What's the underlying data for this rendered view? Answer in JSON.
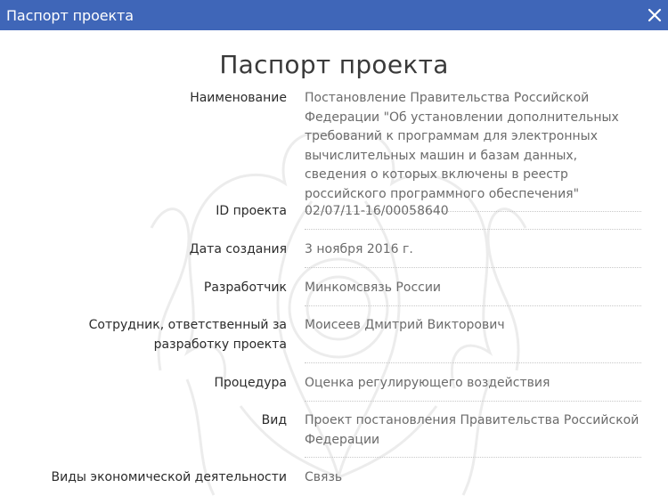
{
  "window": {
    "title": "Паспорт проекта",
    "close_icon": "close-icon"
  },
  "page": {
    "heading": "Паспорт проекта"
  },
  "fields": [
    {
      "label": "Наименование",
      "value": "Постановление Правительства Российской Федерации \"Об установлении дополнительных требований к программам для электронных вычислительных машин и базам данных, сведения о которых включены в реестр российского программного обеспечения\""
    },
    {
      "label": "ID проекта",
      "value": "02/07/11-16/00058640"
    },
    {
      "label": "Дата создания",
      "value": "3 ноября 2016 г."
    },
    {
      "label": "Разработчик",
      "value": "Минкомсвязь России"
    },
    {
      "label": "Сотрудник, ответственный за разработку проекта",
      "value": "Моисеев Дмитрий Викторович"
    },
    {
      "label": "Процедура",
      "value": "Оценка регулирующего воздействия"
    },
    {
      "label": "Вид",
      "value": "Проект постановления Правительства Российской Федерации"
    },
    {
      "label": "Виды экономической деятельности",
      "value": "Связь"
    }
  ],
  "colors": {
    "titlebar": "#3f66b8",
    "label": "#2b2b2b",
    "value": "#6b6b6b"
  }
}
